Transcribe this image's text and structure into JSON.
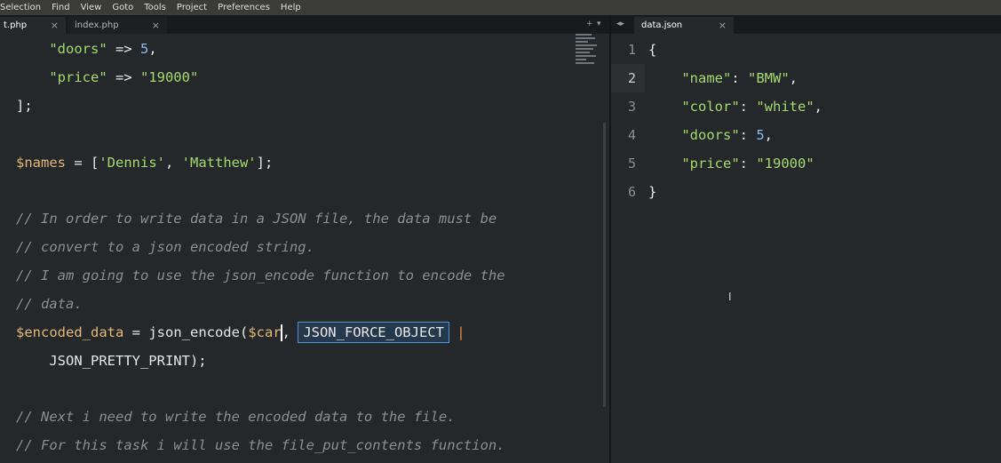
{
  "menu": [
    "Selection",
    "Find",
    "View",
    "Goto",
    "Tools",
    "Project",
    "Preferences",
    "Help"
  ],
  "left_tabs": [
    {
      "label": "t.php",
      "close": "×"
    },
    {
      "label": "index.php",
      "close": "×"
    }
  ],
  "left_tab_controls": {
    "add": "+",
    "menu": "▾"
  },
  "right_tab_controls": {
    "nav": "◂▸"
  },
  "right_tab": {
    "label": "data.json",
    "close": "×"
  },
  "left_code": {
    "doors_key": "\"doors\"",
    "arrow": " => ",
    "doors_val": "5",
    "comma": ",",
    "price_key": "\"price\"",
    "price_val": "\"19000\"",
    "close_bracket": "];",
    "names_var": "$names",
    "assign": " = [",
    "dennis": "'Dennis'",
    "sep": ", ",
    "matthew": "'Matthew'",
    "names_end": "];",
    "comment1": "// In order to write data in a JSON file, the data must be",
    "comment2": "// convert to a json encoded string.",
    "comment3": "// I am going to use the json_encode function to encode the",
    "comment4": "// data.",
    "encoded_var": "$encoded_data",
    "encoded_assign": " = json_encode(",
    "car_var": "$car",
    "car_after": ", ",
    "force_const": "JSON_FORCE_OBJECT",
    "pipe": " |",
    "pretty": "    JSON_PRETTY_PRINT);",
    "comment5": "// Next i need to write the encoded data to the file.",
    "comment6": "// For this task i will use the file_put_contents function."
  },
  "right_code": {
    "line_numbers": [
      "1",
      "2",
      "3",
      "4",
      "5",
      "6"
    ],
    "open_brace": "{",
    "name_key": "\"name\"",
    "name_val": "\"BMW\"",
    "color_key": "\"color\"",
    "color_val": "\"white\"",
    "doors_key": "\"doors\"",
    "doors_val": "5",
    "price_key": "\"price\"",
    "price_val": "\"19000\"",
    "colon": ": ",
    "comma": ",",
    "close_brace": "}"
  },
  "cursor_icon": "I"
}
